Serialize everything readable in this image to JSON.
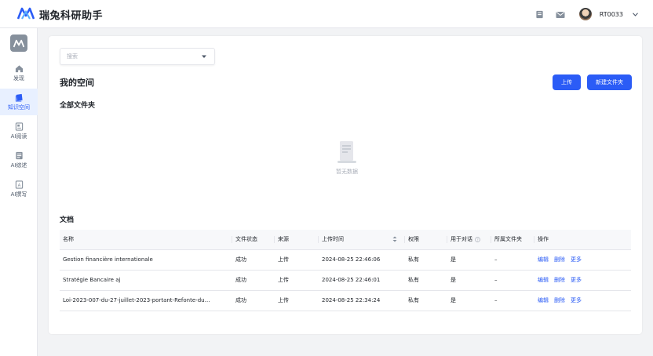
{
  "header": {
    "app_title": "瑞兔科研助手",
    "username": "RT0033",
    "icons": [
      "book-icon",
      "mail-icon",
      "avatar",
      "chevron-down-icon"
    ]
  },
  "sidebar": {
    "items": [
      {
        "label": "发现",
        "icon": "home-icon",
        "active": false
      },
      {
        "label": "知识空间",
        "icon": "book-icon",
        "active": true
      },
      {
        "label": "AI阅读",
        "icon": "reader-icon",
        "active": false
      },
      {
        "label": "AI综述",
        "icon": "summary-icon",
        "active": false
      },
      {
        "label": "AI撰写",
        "icon": "write-icon",
        "active": false
      }
    ]
  },
  "main": {
    "search": {
      "placeholder": "搜索",
      "value": ""
    },
    "space_title": "我的空间",
    "upload_label": "上传",
    "new_folder_label": "新建文件夹",
    "folders_title": "全部文件夹",
    "empty_text": "暂无数据",
    "docs_title": "文档",
    "table": {
      "columns": [
        "名称",
        "文件状态",
        "来源",
        "上传时间",
        "权限",
        "用于对话",
        "所属文件夹",
        "操作"
      ],
      "rows": [
        {
          "name": "Gestion financière internationale",
          "status": "成功",
          "source": "上传",
          "uploaded": "2024-08-25 22:46:06",
          "permission": "私有",
          "for_chat": "是",
          "folder": "–",
          "actions": [
            "编辑",
            "删除",
            "更多"
          ]
        },
        {
          "name": "Stratégie Bancaire aj",
          "status": "成功",
          "source": "上传",
          "uploaded": "2024-08-25 22:46:01",
          "permission": "私有",
          "for_chat": "是",
          "folder": "–",
          "actions": [
            "编辑",
            "删除",
            "更多"
          ]
        },
        {
          "name": "Loi-2023-007-du-27-juillet-2023-portant-Refonte-du…",
          "status": "成功",
          "source": "上传",
          "uploaded": "2024-08-25 22:34:24",
          "permission": "私有",
          "for_chat": "是",
          "folder": "–",
          "actions": [
            "编辑",
            "删除",
            "更多"
          ]
        }
      ]
    }
  },
  "colors": {
    "accent": "#2b5cf6",
    "active_bg": "#e8f0ff",
    "page_bg": "#f2f3f5"
  }
}
